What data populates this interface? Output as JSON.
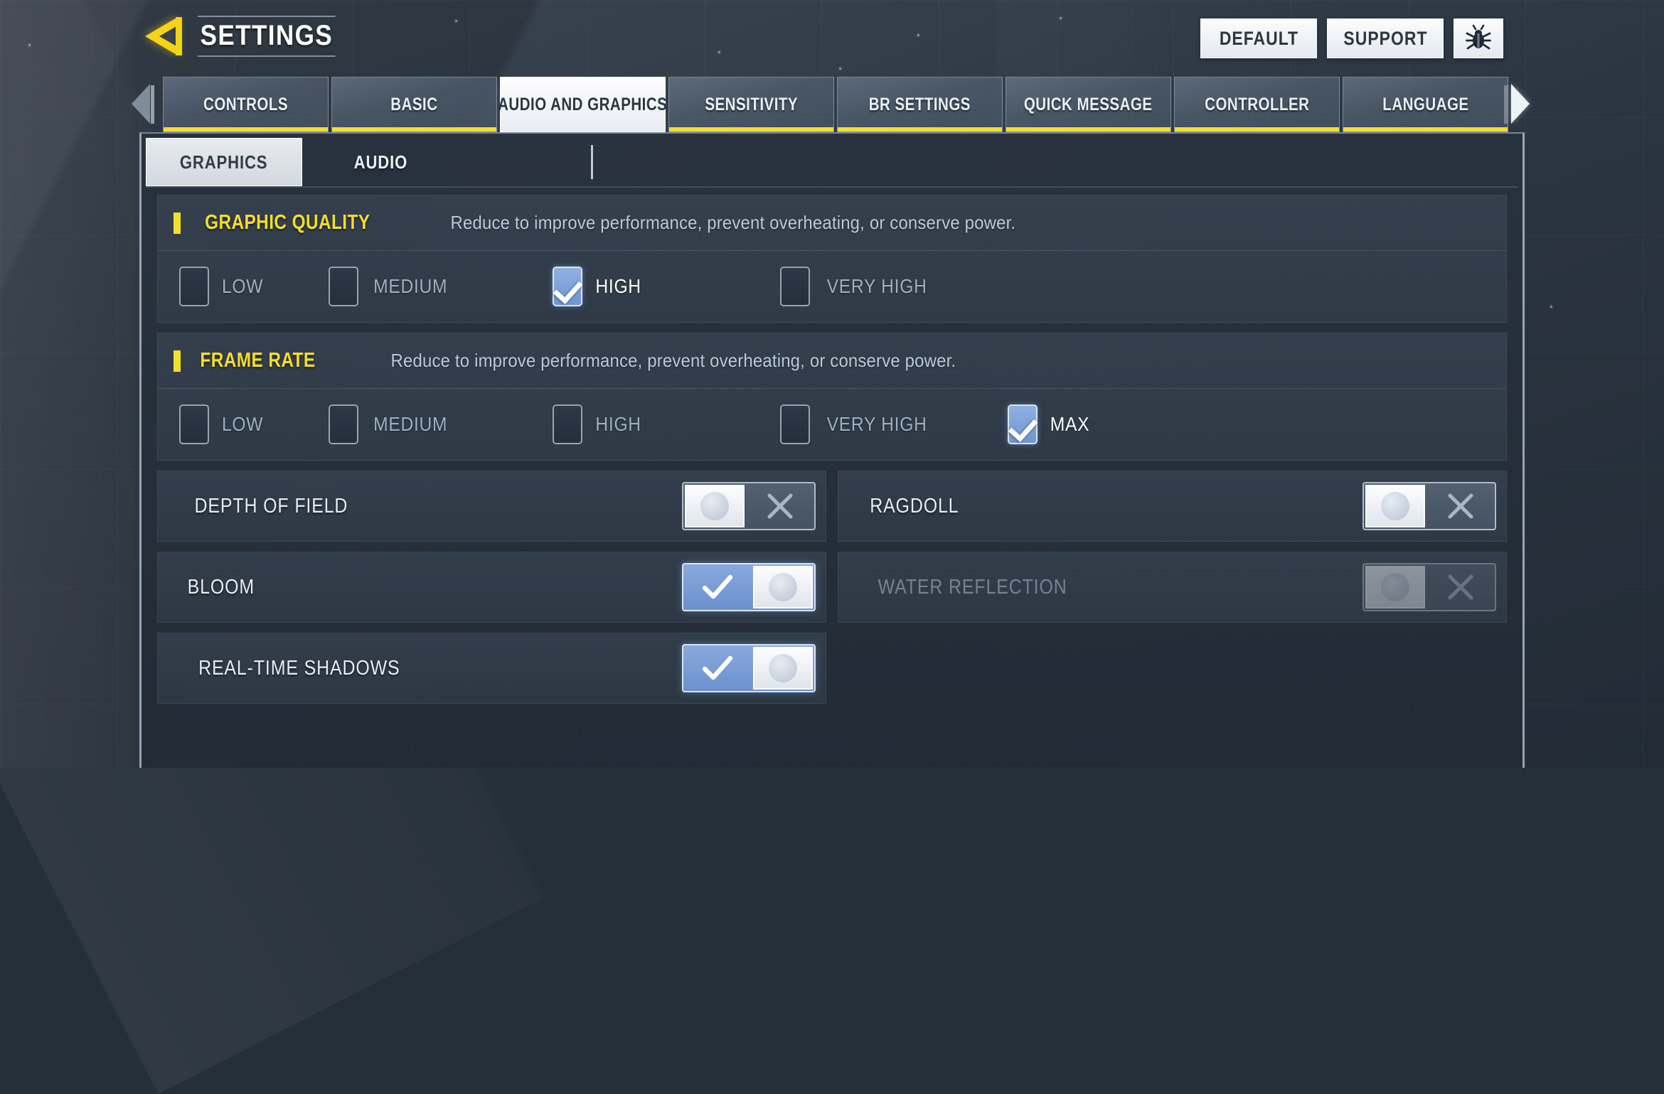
{
  "header": {
    "title": "SETTINGS",
    "back_icon": "back-arrow-icon",
    "buttons": [
      {
        "label": "DEFAULT",
        "name": "default-button"
      },
      {
        "label": "SUPPORT",
        "name": "support-button"
      }
    ],
    "bug_icon": "bug-report-icon"
  },
  "tabs": {
    "left_arrow_icon": "chevron-left-icon",
    "right_arrow_icon": "chevron-right-icon",
    "items": [
      {
        "label": "CONTROLS",
        "active": false
      },
      {
        "label": "BASIC",
        "active": false
      },
      {
        "label": "AUDIO AND GRAPHICS",
        "active": true
      },
      {
        "label": "SENSITIVITY",
        "active": false
      },
      {
        "label": "BR SETTINGS",
        "active": false
      },
      {
        "label": "QUICK MESSAGE",
        "active": false
      },
      {
        "label": "CONTROLLER",
        "active": false
      },
      {
        "label": "LANGUAGE",
        "active": false
      }
    ]
  },
  "subtabs": [
    {
      "label": "GRAPHICS",
      "active": true
    },
    {
      "label": "AUDIO",
      "active": false
    }
  ],
  "sections": [
    {
      "title": "GRAPHIC QUALITY",
      "description": "Reduce to improve performance, prevent overheating, or conserve power.",
      "options": [
        {
          "label": "LOW",
          "checked": false
        },
        {
          "label": "MEDIUM",
          "checked": false
        },
        {
          "label": "HIGH",
          "checked": true
        },
        {
          "label": "VERY HIGH",
          "checked": false
        }
      ]
    },
    {
      "title": "FRAME RATE",
      "description": "Reduce to improve performance, prevent overheating, or conserve power.",
      "options": [
        {
          "label": "LOW",
          "checked": false
        },
        {
          "label": "MEDIUM",
          "checked": false
        },
        {
          "label": "HIGH",
          "checked": false
        },
        {
          "label": "VERY HIGH",
          "checked": false
        },
        {
          "label": "MAX",
          "checked": true
        }
      ]
    }
  ],
  "toggles": {
    "left_column": [
      {
        "label": "DEPTH OF FIELD",
        "on": false,
        "disabled": false
      },
      {
        "label": "BLOOM",
        "on": true,
        "disabled": false
      },
      {
        "label": "REAL-TIME SHADOWS",
        "on": true,
        "disabled": false
      }
    ],
    "right_column": [
      {
        "label": "RAGDOLL",
        "on": false,
        "disabled": false
      },
      {
        "label": "WATER REFLECTION",
        "on": false,
        "disabled": true
      }
    ]
  },
  "colors": {
    "accent_yellow": "#f5dd2e",
    "toggle_blue": "#6f96d2",
    "panel_dark": "#2b3541",
    "text_light": "#e6edf4"
  }
}
